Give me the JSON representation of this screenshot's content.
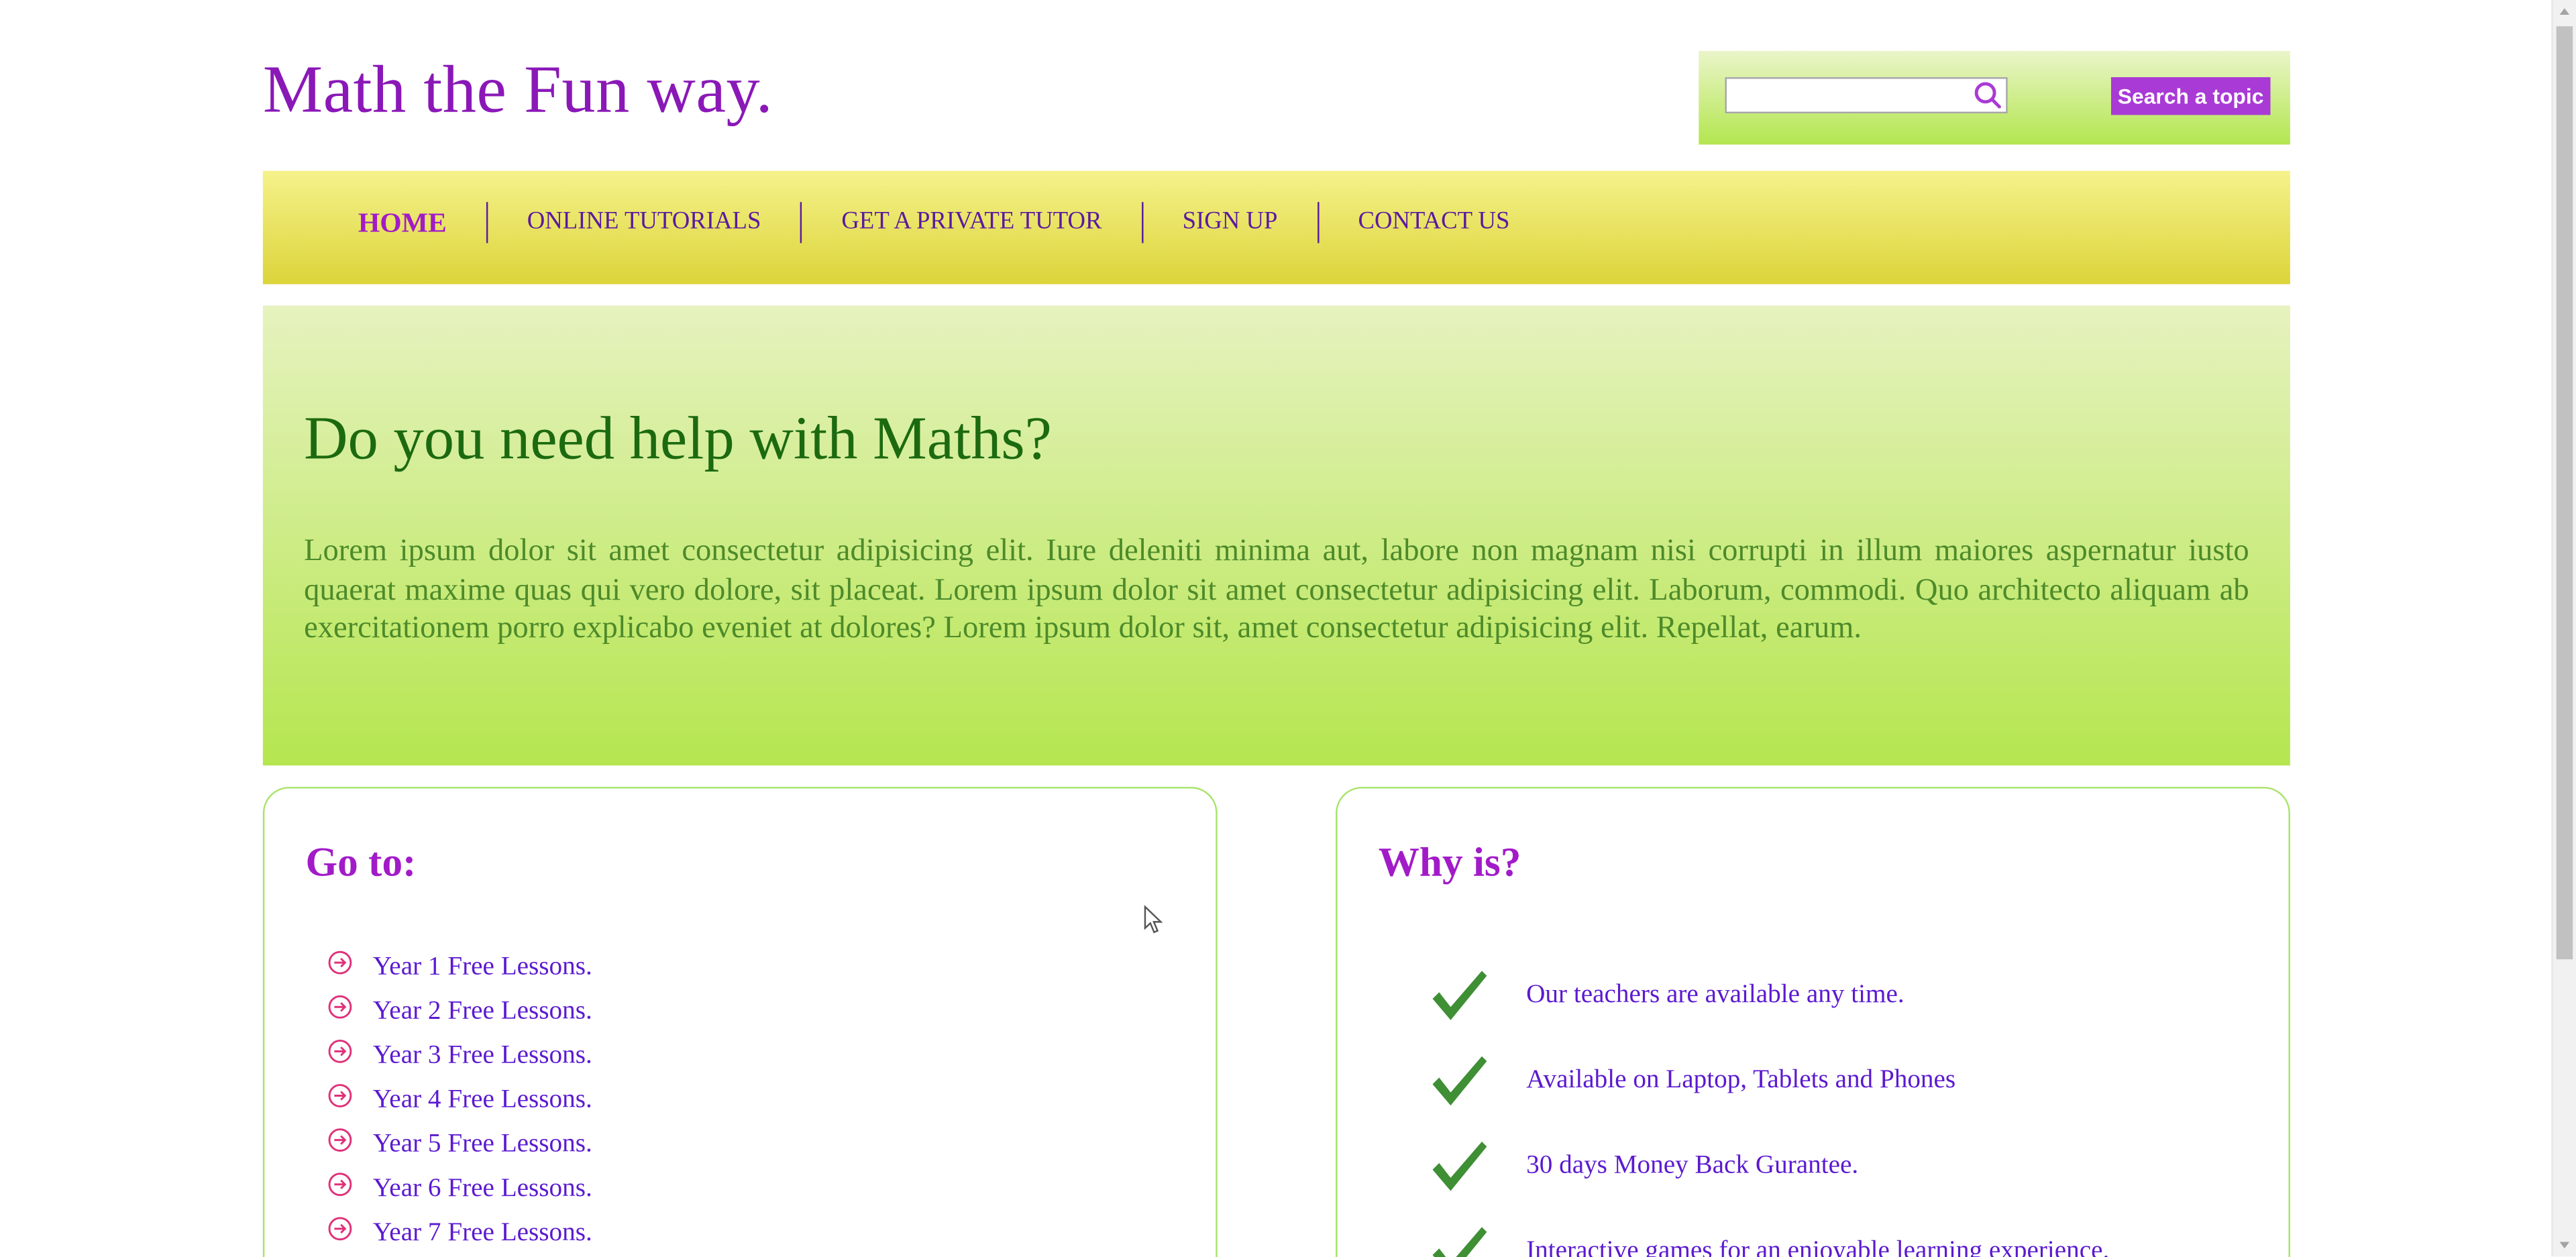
{
  "header": {
    "site_title": "Math the Fun way.",
    "search": {
      "value": "",
      "placeholder": "",
      "button_label": "Search a topic"
    }
  },
  "nav": {
    "items": [
      {
        "label": "HOME",
        "active": true
      },
      {
        "label": "ONLINE TUTORIALS",
        "active": false
      },
      {
        "label": "GET A PRIVATE TUTOR",
        "active": false
      },
      {
        "label": "SIGN UP",
        "active": false
      },
      {
        "label": "CONTACT US",
        "active": false
      }
    ]
  },
  "hero": {
    "title": "Do you need help with Maths?",
    "text": "Lorem ipsum dolor sit amet consectetur adipisicing elit. Iure deleniti minima aut, labore non magnam nisi corrupti in illum maiores aspernatur iusto quaerat maxime quas qui vero dolore, sit placeat. Lorem ipsum dolor sit amet consectetur adipisicing elit. Laborum, commodi. Quo architecto aliquam ab exercitationem porro explicabo eveniet at dolores? Lorem ipsum dolor sit, amet consectetur adipisicing elit. Repellat, earum."
  },
  "goto": {
    "title": "Go to:",
    "items": [
      "Year 1 Free Lessons.",
      "Year 2 Free Lessons.",
      "Year 3 Free Lessons.",
      "Year 4 Free Lessons.",
      "Year 5 Free Lessons.",
      "Year 6 Free Lessons.",
      "Year 7 Free Lessons."
    ]
  },
  "why": {
    "title": "Why is?",
    "items": [
      "Our teachers are available any time.",
      "Available on Laptop, Tablets and Phones",
      "30 days Money Back Gurantee.",
      "Interactive games for an enjoyable learning experience."
    ]
  },
  "icons": {
    "search": "search-icon",
    "lesson_bullet": "circle-arrow-right-icon",
    "why_bullet": "checkmark-icon",
    "cursor": "mouse-pointer-icon"
  },
  "colors": {
    "brand_purple": "#8a18b7",
    "nav_yellow": "#f5f28b",
    "hero_green": "#b5e64f",
    "heading_green": "#1c6a10",
    "link_violet": "#5b1ad0",
    "check_green": "#3f8f35"
  }
}
